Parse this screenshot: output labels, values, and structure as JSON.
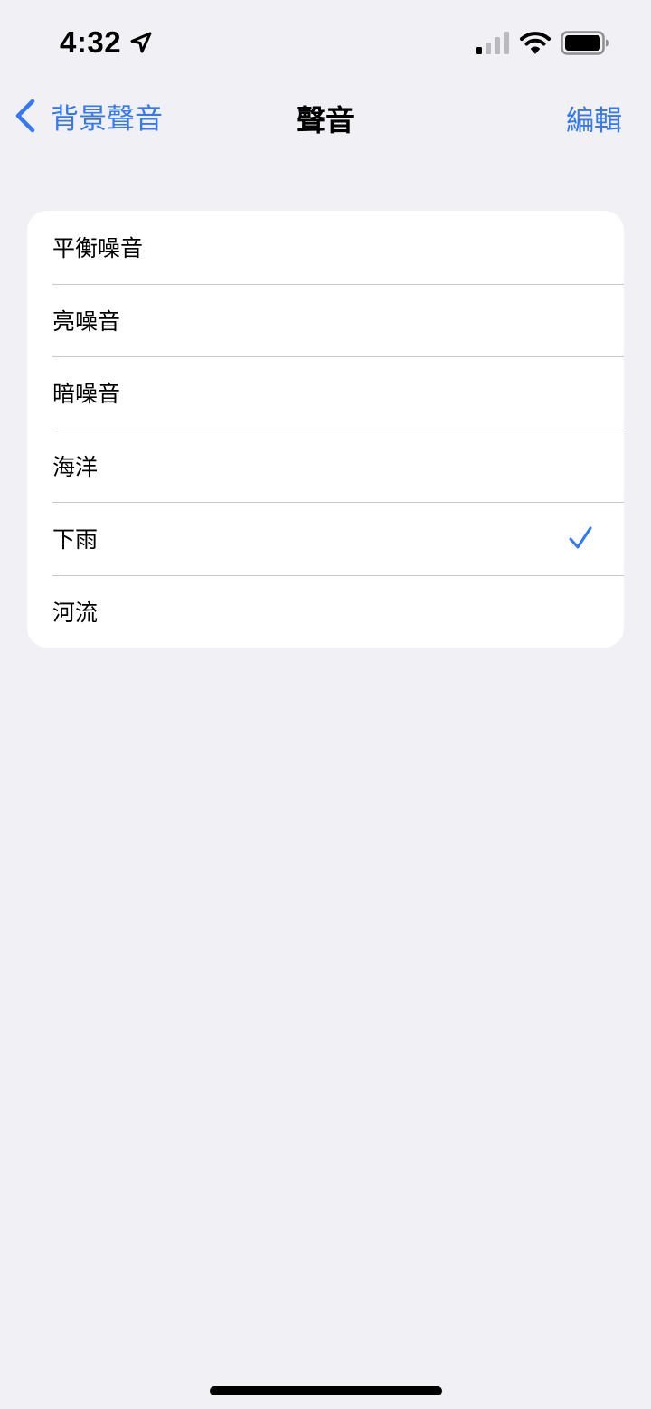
{
  "status_bar": {
    "time": "4:32",
    "location_icon": "location-arrow-icon",
    "signal_icon": "cellular-signal-icon",
    "signal_bars_active": 1,
    "signal_bars_total": 4,
    "wifi_icon": "wifi-icon",
    "battery_icon": "battery-icon",
    "battery_level": 1.0
  },
  "nav": {
    "back_label": "背景聲音",
    "title": "聲音",
    "edit_label": "編輯"
  },
  "sounds": [
    {
      "label": "平衡噪音",
      "selected": false
    },
    {
      "label": "亮噪音",
      "selected": false
    },
    {
      "label": "暗噪音",
      "selected": false
    },
    {
      "label": "海洋",
      "selected": false
    },
    {
      "label": "下雨",
      "selected": true
    },
    {
      "label": "河流",
      "selected": false
    }
  ],
  "colors": {
    "accent": "#3478f6",
    "background": "#f0f0f5",
    "card": "#ffffff",
    "separator": "#c8c8cc"
  }
}
